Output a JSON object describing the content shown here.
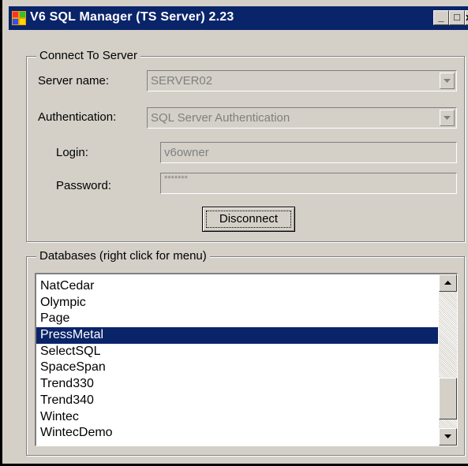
{
  "window": {
    "title": "V6 SQL Manager (TS Server)  2.23",
    "buttons": {
      "minimize": "_",
      "maximize": "□",
      "close": "x"
    }
  },
  "connect": {
    "group_label": "Connect To Server",
    "server_label": "Server name:",
    "server_value": "SERVER02",
    "auth_label": "Authentication:",
    "auth_value": "SQL Server Authentication",
    "login_label": "Login:",
    "login_value": "v6owner",
    "password_label": "Password:",
    "password_value": "*******",
    "disconnect_label": "Disconnect"
  },
  "databases": {
    "group_label": "Databases (right click for menu)",
    "items": [
      "NatCedar",
      "Olympic",
      "Page",
      "PressMetal",
      "SelectSQL",
      "SpaceSpan",
      "Trend330",
      "Trend340",
      "Wintec",
      "WintecDemo"
    ],
    "selected": "PressMetal"
  },
  "colors": {
    "titlebar": "#0a246a",
    "selection": "#0a246a",
    "face": "#d4d0c8"
  }
}
